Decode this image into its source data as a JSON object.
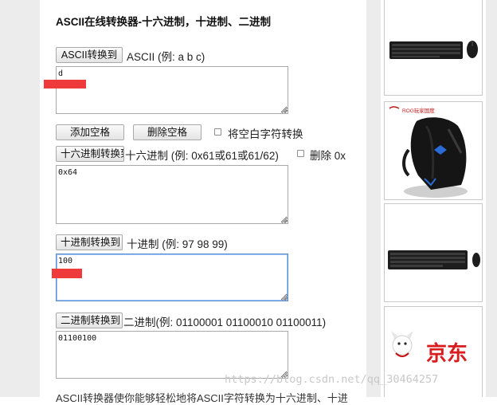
{
  "title": "ASCII在线转换器-十六进制，十进制、二进制",
  "ascii": {
    "button": "ASCII转换到",
    "label": "ASCII (例: a b c)",
    "value": "d"
  },
  "actions": {
    "add_space": "添加空格",
    "remove_space": "删除空格",
    "whitespace_checkbox_label": "将空白字符转换",
    "whitespace_checked": false
  },
  "hex": {
    "button": "十六进制转换到",
    "label": "十六进制 (例: 0x61或61或61/62)",
    "remove_0x_label": "删除 0x",
    "remove_0x_checked": false,
    "value": "0x64"
  },
  "decimal": {
    "button": "十进制转换到",
    "label": "十进制 (例: 97 98 99)",
    "value": "100"
  },
  "binary": {
    "button": "二进制转换到",
    "label": "二进制(例: 01100001 01100010 01100011)",
    "value": "01100100"
  },
  "footer_text": "ASCII转换器使你能够轻松地将ASCII字符转换为十六进制、十进",
  "watermark": "https://blog.csdn.net/qq_30464257",
  "ads": {
    "gaming_brand": "ROG玩家国度",
    "store_name": "京东"
  }
}
